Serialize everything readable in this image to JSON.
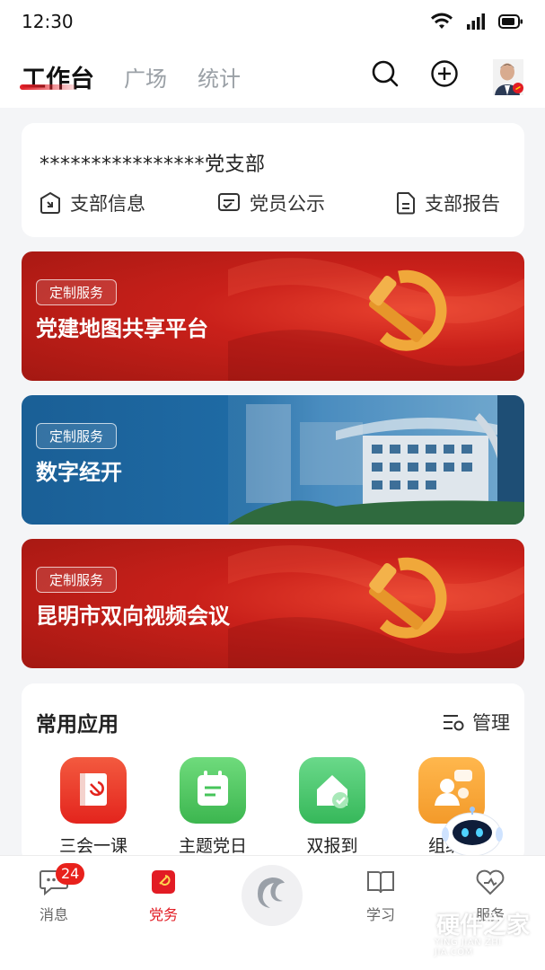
{
  "status_bar": {
    "time": "12:30"
  },
  "header": {
    "tabs": [
      {
        "label": "工作台",
        "active": true
      },
      {
        "label": "广场",
        "active": false
      },
      {
        "label": "统计",
        "active": false
      }
    ],
    "icons": [
      "search-icon",
      "add-icon",
      "avatar"
    ]
  },
  "branch": {
    "title": "****************党支部",
    "links": [
      {
        "label": "支部信息",
        "icon": "info-enter-icon"
      },
      {
        "label": "党员公示",
        "icon": "publicity-icon"
      },
      {
        "label": "支部报告",
        "icon": "report-icon"
      }
    ]
  },
  "banners": [
    {
      "tag": "定制服务",
      "title": "党建地图共享平台",
      "theme": "red"
    },
    {
      "tag": "定制服务",
      "title": "数字经开",
      "theme": "blue"
    },
    {
      "tag": "定制服务",
      "title": "昆明市双向视频会议",
      "theme": "red"
    }
  ],
  "apps": {
    "title": "常用应用",
    "manage_label": "管理",
    "items": [
      {
        "label": "三会一课",
        "color": "#e8352b"
      },
      {
        "label": "主题党日",
        "color": "#46c45a"
      },
      {
        "label": "双报到",
        "color": "#4cc36a"
      },
      {
        "label": "组织",
        "color": "#f6a43a"
      }
    ]
  },
  "bottom_nav": {
    "items": [
      {
        "label": "消息",
        "badge": "24",
        "active": false
      },
      {
        "label": "党务",
        "active": true
      },
      {
        "label": "",
        "center": true
      },
      {
        "label": "学习",
        "active": false
      },
      {
        "label": "服务",
        "active": false
      }
    ]
  },
  "watermark": {
    "text": "硬件之家",
    "sub": "YING JIAN ZHI JIA.COM"
  },
  "colors": {
    "accent": "#e21c24",
    "blue_banner": "#1f6ba5"
  }
}
